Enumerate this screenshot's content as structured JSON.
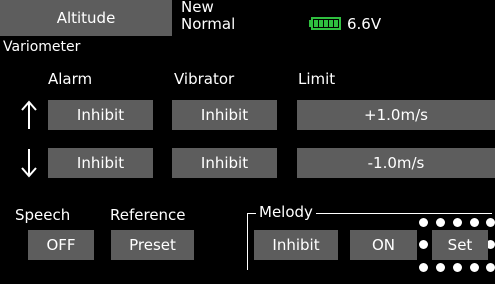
{
  "header": {
    "tab_label": "Altitude",
    "model_line1": "New",
    "model_line2": "Normal",
    "battery_voltage": "6.6V",
    "section_title": "Variometer"
  },
  "columns": {
    "alarm": "Alarm",
    "vibrator": "Vibrator",
    "limit": "Limit"
  },
  "rows": {
    "up": {
      "alarm": "Inhibit",
      "vibrator": "Inhibit",
      "limit": "+1.0m/s",
      "arrow": "up-arrow-icon"
    },
    "down": {
      "alarm": "Inhibit",
      "vibrator": "Inhibit",
      "limit": "-1.0m/s",
      "arrow": "down-arrow-icon"
    }
  },
  "speech": {
    "label": "Speech",
    "value": "OFF"
  },
  "reference": {
    "label": "Reference",
    "value": "Preset"
  },
  "melody": {
    "label": "Melody",
    "inhibit": "Inhibit",
    "on": "ON",
    "set": "Set"
  },
  "colors": {
    "background": "#000000",
    "button": "#5d5d5d",
    "battery": "#2fbf3f",
    "text": "#ffffff"
  }
}
